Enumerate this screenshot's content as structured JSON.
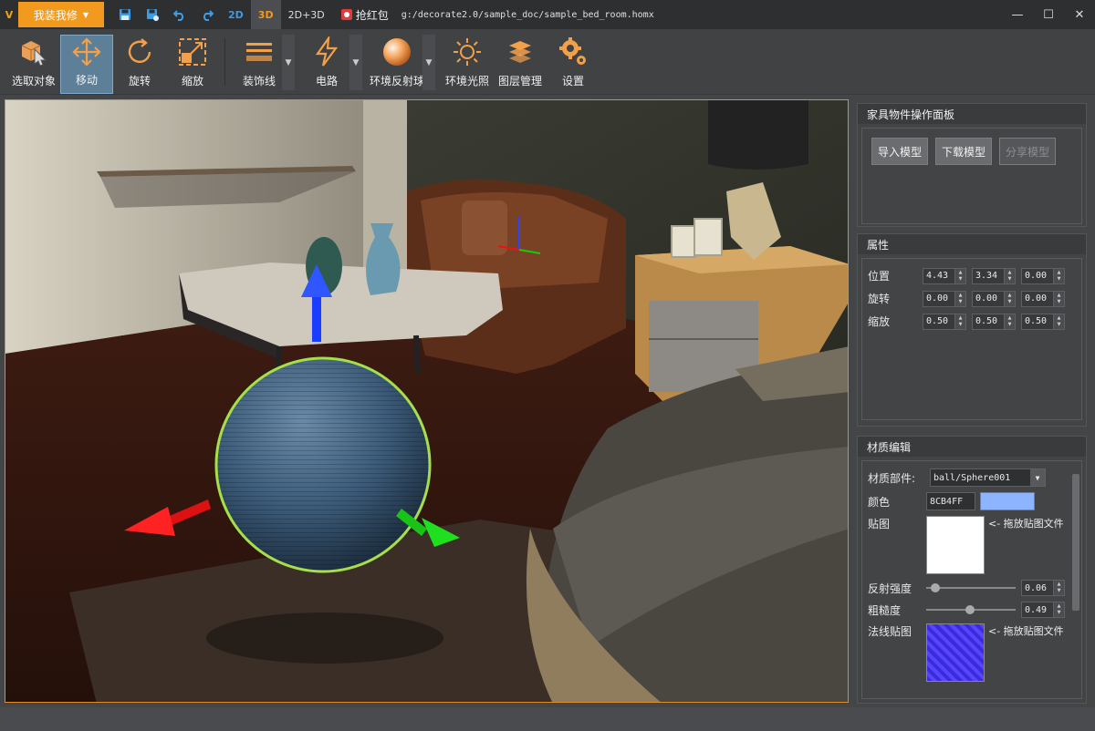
{
  "titlebar": {
    "logo": "V",
    "main_menu": "我装我修",
    "mode_2d": "2D",
    "mode_3d": "3D",
    "mode_2d3d": "2D+3D",
    "red_packet": "抢红包",
    "file_path": "g:/decorate2.0/sample_doc/sample_bed_room.homx"
  },
  "toolbar": {
    "select": "选取对象",
    "move": "移动",
    "rotate": "旋转",
    "scale": "缩放",
    "trim": "装饰线",
    "circuit": "电路",
    "env_sphere": "环境反射球",
    "env_light": "环境光照",
    "layers": "图层管理",
    "settings": "设置"
  },
  "furniture_panel": {
    "title": "家具物件操作面板",
    "import": "导入模型",
    "download": "下载模型",
    "share": "分享模型"
  },
  "properties": {
    "title": "属性",
    "rows": [
      {
        "label": "位置",
        "values": [
          "4.43",
          "3.34",
          "0.00"
        ]
      },
      {
        "label": "旋转",
        "values": [
          "0.00",
          "0.00",
          "0.00"
        ]
      },
      {
        "label": "缩放",
        "values": [
          "0.50",
          "0.50",
          "0.50"
        ]
      }
    ]
  },
  "material": {
    "title": "材质编辑",
    "part_label": "材质部件:",
    "part_value": "ball/Sphere001",
    "color_label": "颜色",
    "color_hex": "8CB4FF",
    "color_swatch": "#8CB4FF",
    "texture_label": "贴图",
    "drop_hint": "<- 拖放贴图文件",
    "reflect_label": "反射强度",
    "reflect_value": "0.06",
    "reflect_level": 0.06,
    "rough_label": "粗糙度",
    "rough_value": "0.49",
    "rough_level": 0.49,
    "normal_label": "法线贴图",
    "normal_drop_hint": "<- 拖放贴图文件"
  },
  "colors": {
    "accent": "#F29A1D",
    "selection_outline": "#A5E04A"
  }
}
